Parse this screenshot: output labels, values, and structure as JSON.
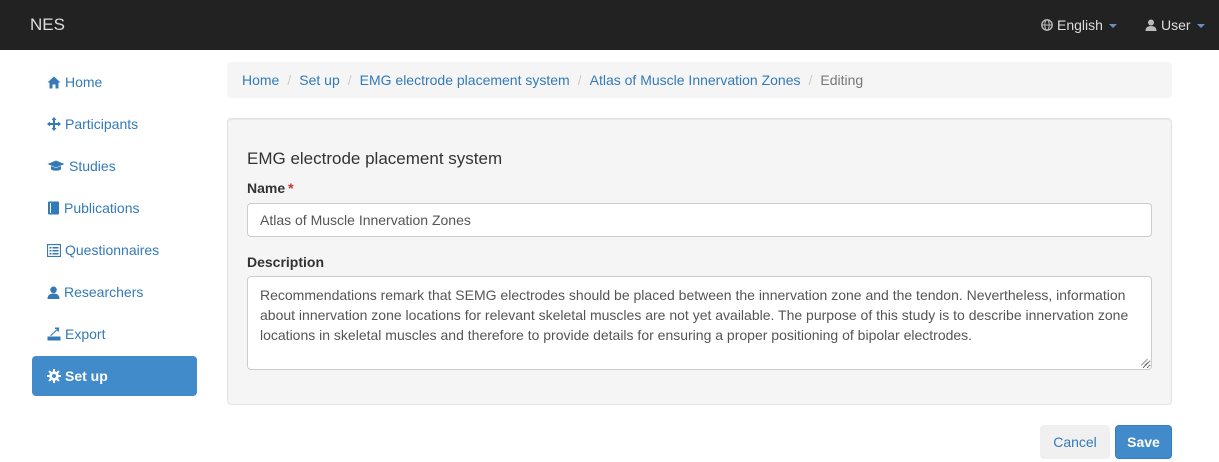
{
  "navbar": {
    "brand": "NES",
    "language": "English",
    "user": "User",
    "icons": {
      "language": "globe-icon",
      "user": "user-icon"
    }
  },
  "sidebar": {
    "items": [
      {
        "label": "Home",
        "icon": "home-icon"
      },
      {
        "label": "Participants",
        "icon": "move-icon"
      },
      {
        "label": "Studies",
        "icon": "graduation-cap-icon"
      },
      {
        "label": "Publications",
        "icon": "book-icon"
      },
      {
        "label": "Questionnaires",
        "icon": "list-alt-icon"
      },
      {
        "label": "Researchers",
        "icon": "user-icon"
      },
      {
        "label": "Export",
        "icon": "export-icon"
      },
      {
        "label": "Set up",
        "icon": "cog-icon",
        "active": true
      }
    ]
  },
  "breadcrumb": {
    "items": [
      "Home",
      "Set up",
      "EMG electrode placement system",
      "Atlas of Muscle Innervation Zones"
    ],
    "current": "Editing"
  },
  "form": {
    "title": "EMG electrode placement system",
    "name_label": "Name",
    "required_mark": "*",
    "name_value": "Atlas of Muscle Innervation Zones",
    "description_label": "Description",
    "description_value": "Recommendations remark that SEMG electrodes should be placed between the innervation zone and the tendon. Nevertheless, information about innervation zone locations for relevant skeletal muscles are not yet available. The purpose of this study is to describe innervation zone locations in skeletal muscles and therefore to provide details for ensuring a proper positioning of bipolar electrodes."
  },
  "actions": {
    "cancel": "Cancel",
    "save": "Save"
  },
  "colors": {
    "navbar_bg": "#222222",
    "link": "#337ab7",
    "primary": "#428bca",
    "panel_bg": "#f5f5f5",
    "required": "#c9302c"
  }
}
